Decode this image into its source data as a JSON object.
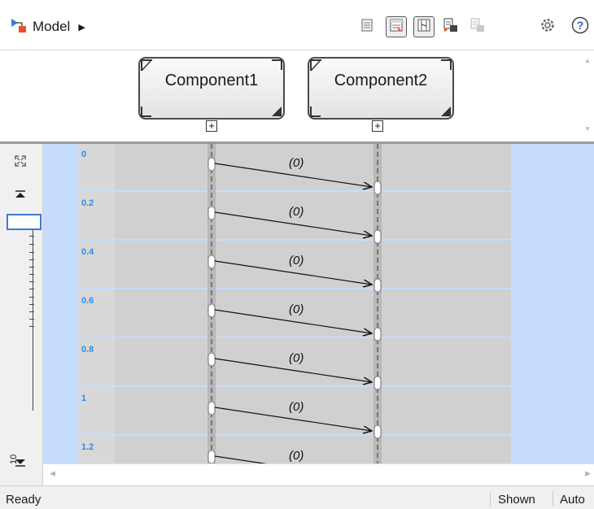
{
  "toolbar": {
    "model_label": "Model",
    "icons": [
      "model-block-icon",
      "breadcrumb-arrow-icon",
      "list-view-icon",
      "open-design-icon",
      "show-activation-icon",
      "export-icon",
      "export-disabled-icon",
      "settings-icon",
      "help-icon"
    ]
  },
  "components": [
    {
      "name": "Component1"
    },
    {
      "name": "Component2"
    }
  ],
  "timeline": {
    "times": [
      "0",
      "0.2",
      "0.4",
      "0.6",
      "0.8",
      "1",
      "1.2"
    ],
    "message_label": "(0)"
  },
  "ruler": {
    "label": "10"
  },
  "status": {
    "text": "Ready",
    "shown": "Shown",
    "auto": "Auto"
  },
  "colors": {
    "canvas_background": "#c6dcff",
    "lane_background": "#d0d0d0",
    "time_label": "#2f8ce8",
    "separator": "#c6dcff"
  }
}
